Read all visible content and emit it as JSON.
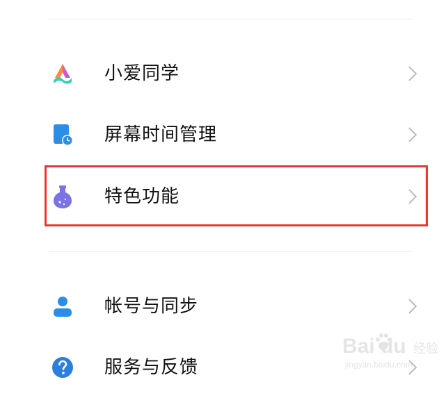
{
  "menu": {
    "items": [
      {
        "id": "xiaoai",
        "label": "小爱同学",
        "icon": "xiaoai-assistant-icon"
      },
      {
        "id": "screen-time",
        "label": "屏幕时间管理",
        "icon": "screen-time-icon"
      },
      {
        "id": "special-features",
        "label": "特色功能",
        "icon": "flask-icon",
        "highlighted": true
      },
      {
        "id": "account-sync",
        "label": "帐号与同步",
        "icon": "account-person-icon"
      },
      {
        "id": "service-feedback",
        "label": "服务与反馈",
        "icon": "help-question-icon"
      }
    ]
  },
  "highlight": {
    "color": "#e23a2e"
  },
  "watermark": {
    "logo": "Bai du",
    "sub": "经验",
    "url": "jingyan.baidu.com"
  },
  "colors": {
    "text": "#111111",
    "chevron": "#bdbdbd",
    "divider": "#ececec",
    "screen_time_blue": "#2b8de6",
    "flask_purple": "#7b72e6",
    "account_blue": "#2b8de6",
    "help_blue": "#2b7fe0"
  }
}
